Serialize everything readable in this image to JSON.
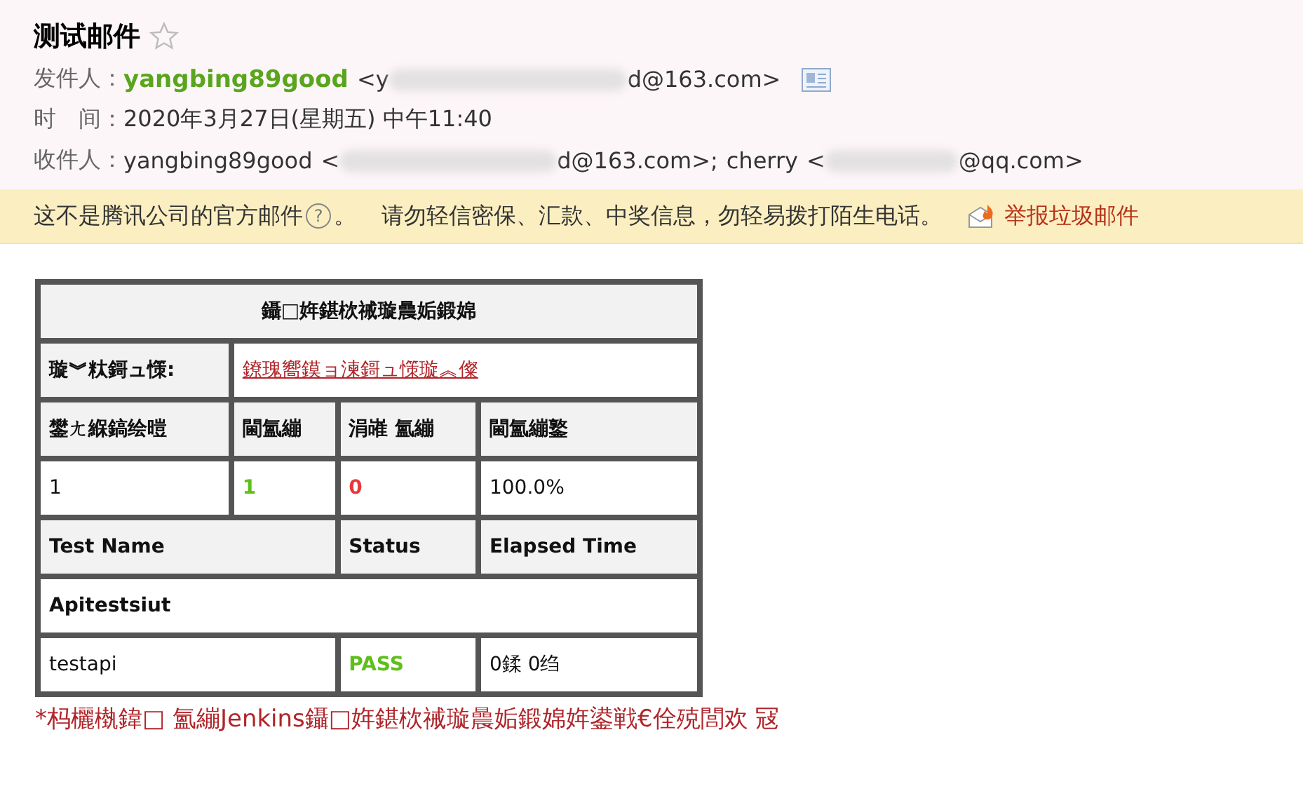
{
  "email": {
    "subject": "测试邮件",
    "starred": false,
    "sender_label": "发件人：",
    "sender_name": "yangbing89good",
    "sender_address_start": "<y",
    "sender_address_end": "d@163.com>",
    "time_label": "时　间：",
    "time": "2020年3月27日(星期五) 中午11:40",
    "recipients_label": "收件人：",
    "recipients": [
      {
        "name": "yangbing89good",
        "address_start": "<",
        "address_end": "d@163.com>;"
      },
      {
        "name": "cherry",
        "address_start": "<",
        "address_end": "@qq.com>"
      }
    ]
  },
  "notice": {
    "text": "这不是腾讯公司的官方邮件",
    "help": "?",
    "period": "。",
    "warning": "请勿轻信密保、汇款、中奖信息，勿轻易拨打陌生电话。",
    "report_link": "举报垃圾邮件"
  },
  "report": {
    "title": "鑷□姩鍖栨祴璇曟姤鍛婂",
    "detail_label": "璇︾粏鎶ュ憡:",
    "detail_link": "鐐瑰嚮鏌ョ湅鎶ュ憡璇︽儏",
    "summary_columns": [
      "鐢ㄤ緥鎬绘暟",
      "閫氳繃",
      "涓嶉 氳繃",
      "閫氳繃鐜"
    ],
    "summary": {
      "total": "1",
      "passed": "1",
      "failed": "0",
      "rate": "100.0%"
    },
    "test_columns": [
      "Test Name",
      "Status",
      "Elapsed Time"
    ],
    "suites": [
      {
        "name": "Apitestsiut",
        "tests": [
          {
            "name": "testapi",
            "status": "PASS",
            "passed": true,
            "elapsed": "0鍒 0绉"
          }
        ]
      }
    ],
    "footnote": "*杩欐槸鍏□ 氳繃Jenkins鑷□姩鍖栨祴璇曟姤鍛婂姩鍙戦€佺殑閭欢 冦"
  }
}
